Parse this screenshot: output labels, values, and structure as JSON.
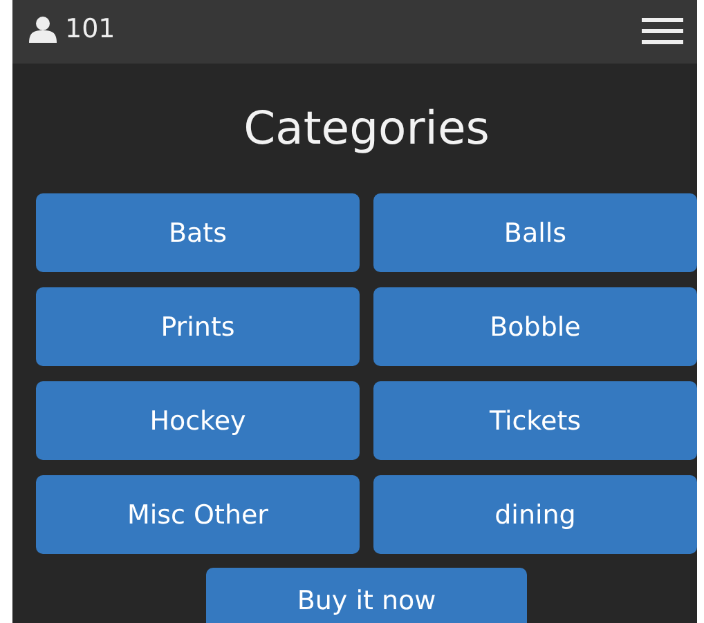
{
  "header": {
    "user_count": "101"
  },
  "title": "Categories",
  "categories": [
    "Bats",
    "Balls",
    "Prints",
    "Bobble",
    "Hockey",
    "Tickets",
    "Misc Other",
    "dining"
  ],
  "buy_button": "Buy it now"
}
